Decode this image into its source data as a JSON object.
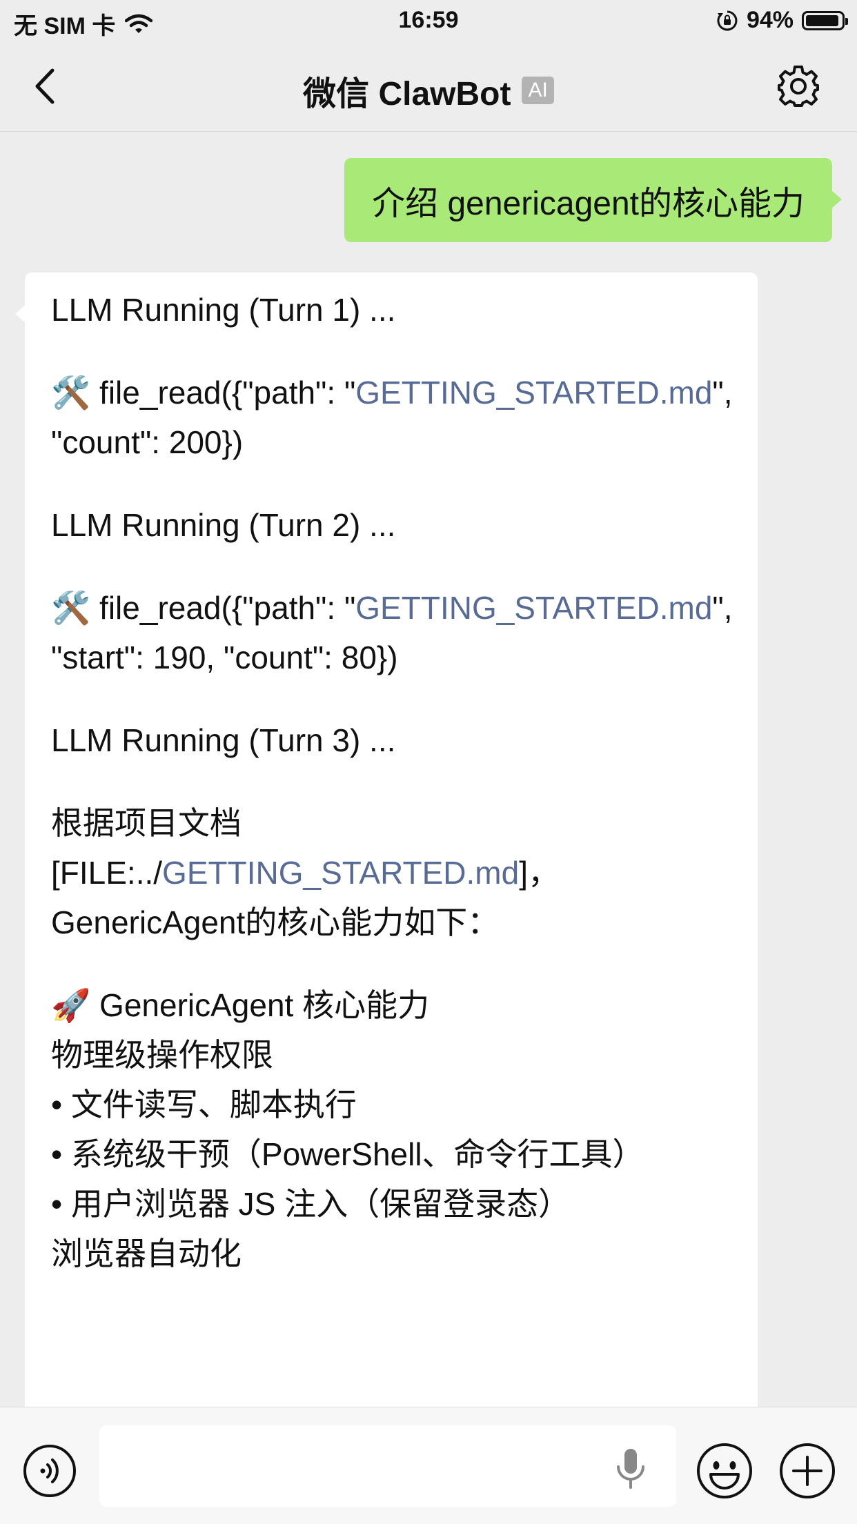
{
  "status_bar": {
    "carrier": "无 SIM 卡",
    "time": "16:59",
    "battery": "94%",
    "battery_level": 0.94
  },
  "nav": {
    "title": "微信 ClawBot",
    "badge": "AI",
    "icons": {
      "back": "chevron-left-icon",
      "settings": "gear-icon"
    }
  },
  "chat": {
    "user_message": "介绍 genericagent的核心能力",
    "bot_message": {
      "turn1": "LLM Running (Turn 1) ...",
      "call1": {
        "emoji": "🛠️",
        "prefix": " file_read({\"path\": \"",
        "link": "GETTING_STARTED.md",
        "suffix": "\", \"count\": 200})"
      },
      "turn2": "LLM Running (Turn 2) ...",
      "call2": {
        "emoji": "🛠️",
        "prefix": " file_read({\"path\": \"",
        "link": "GETTING_STARTED.md",
        "suffix": "\", \"start\": 190, \"count\": 80})"
      },
      "turn3": "LLM Running (Turn 3) ...",
      "summary": {
        "prefix": "根据项目文档 [FILE:../",
        "link": "GETTING_STARTED.md",
        "suffix": "]， GenericAgent的核心能力如下："
      },
      "section": {
        "emoji": "🚀",
        "title": " GenericAgent 核心能力",
        "subheading1": "物理级操作权限",
        "bullets": [
          "• 文件读写、脚本执行",
          "• 系统级干预（PowerShell、命令行工具）",
          "• 用户浏览器 JS 注入（保留登录态）"
        ],
        "subheading2": "浏览器自动化"
      }
    }
  },
  "input_bar": {
    "placeholder": "",
    "icons": {
      "voice": "voice-icon",
      "mic": "microphone-icon",
      "emoji": "emoji-icon",
      "plus": "plus-icon"
    }
  },
  "colors": {
    "background": "#ededed",
    "user_bubble": "#a9e978",
    "bot_bubble": "#ffffff",
    "link": "#576b95",
    "ai_badge": "#b3b3b3"
  }
}
